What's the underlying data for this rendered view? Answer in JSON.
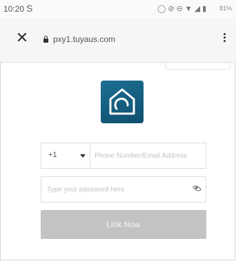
{
  "status_bar": {
    "time": "10:20",
    "app_indicator": "S",
    "battery": "81%"
  },
  "browser": {
    "url": "pxy1.tuyaus.com"
  },
  "form": {
    "country_code": "+1",
    "phone_placeholder": "Phone Number/Email Address",
    "password_placeholder": "Type your password here",
    "submit_label": "Link Now"
  },
  "colors": {
    "logo": "#1d6f94",
    "button_disabled": "#c3c3c3"
  }
}
